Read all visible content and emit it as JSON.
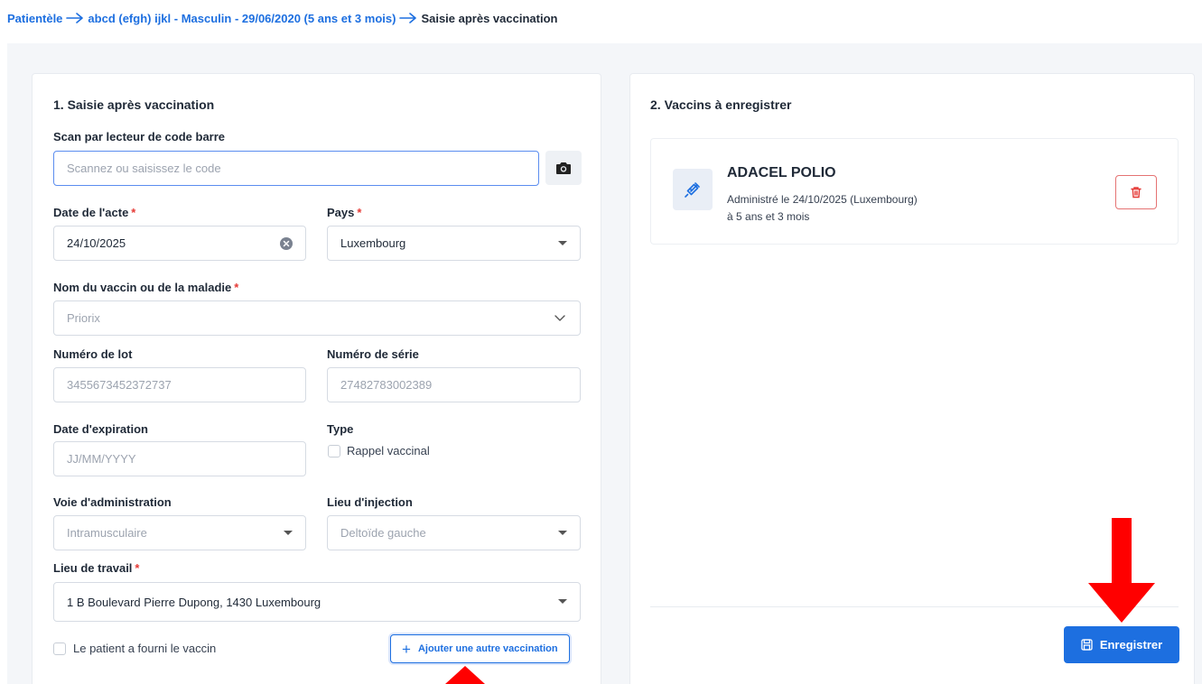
{
  "breadcrumb": {
    "root": "Patientèle",
    "patient": "abcd (efgh) ijkl - Masculin - 29/06/2020 (5 ans et 3 mois)",
    "current": "Saisie après vaccination"
  },
  "left_panel": {
    "title": "1. Saisie après vaccination",
    "scan": {
      "label": "Scan par lecteur de code barre",
      "placeholder": "Scannez ou saisissez le code"
    },
    "date_acte": {
      "label": "Date de l'acte",
      "required": "*",
      "value": "24/10/2025"
    },
    "pays": {
      "label": "Pays",
      "required": "*",
      "value": "Luxembourg"
    },
    "vaccin": {
      "label": "Nom du vaccin ou de la maladie",
      "required": "*",
      "placeholder": "Priorix"
    },
    "lot": {
      "label": "Numéro de lot",
      "placeholder": "3455673452372737"
    },
    "serie": {
      "label": "Numéro de série",
      "placeholder": "27482783002389"
    },
    "expiration": {
      "label": "Date d'expiration",
      "placeholder": "JJ/MM/YYYY"
    },
    "type": {
      "label": "Type",
      "option": "Rappel vaccinal",
      "checked": false
    },
    "voie": {
      "label": "Voie d'administration",
      "placeholder": "Intramusculaire"
    },
    "lieu_injection": {
      "label": "Lieu d'injection",
      "placeholder": "Deltoïde gauche"
    },
    "lieu_travail": {
      "label": "Lieu de travail",
      "required": "*",
      "value": "1 B Boulevard Pierre Dupong, 1430 Luxembourg"
    },
    "fourni": {
      "label": "Le patient a fourni le vaccin",
      "checked": false
    },
    "add_button": "Ajouter une autre vaccination"
  },
  "right_panel": {
    "title": "2. Vaccins à enregistrer",
    "vaccines": [
      {
        "name": "ADACEL POLIO",
        "administered": "Administré le 24/10/2025 (Luxembourg)",
        "age": "à 5 ans et 3 mois"
      }
    ],
    "save_button": "Enregistrer"
  },
  "colors": {
    "accent": "#1d6fe0",
    "danger": "#e53935",
    "annotation_arrow": "#ff0000"
  },
  "icons": [
    "camera-icon",
    "clear-circle-icon",
    "caret-down-icon",
    "chevron-down-icon",
    "syringe-icon",
    "trash-icon",
    "plus-icon",
    "save-icon",
    "arrow-right-icon"
  ]
}
